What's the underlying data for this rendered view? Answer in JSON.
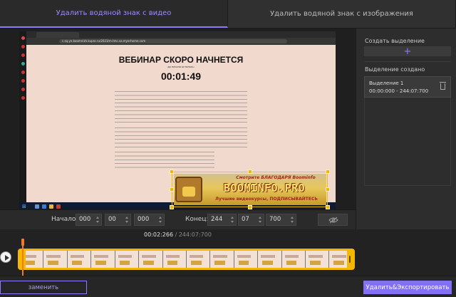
{
  "tabs": [
    {
      "label": "Удалить водяной знак с видео",
      "active": true
    },
    {
      "label": "Удалить водяной знак с изображения",
      "active": false
    }
  ],
  "accent_color": "#8b7cff",
  "selection_color": "#f5b800",
  "video": {
    "address": "c.sq.ye.baomnizh.kupro.ru/2023/m.tmc.sa.myerhome.com",
    "page_title": "ВЕБИНАР СКОРО НАЧНЕТСЯ",
    "page_subtitle": "до начала осталось:",
    "page_timer": "00:01:49",
    "watermark": {
      "top": "Смотрите БЛАГОДАРЯ Boominfo",
      "main": "BOOMINFO.PRO",
      "bottom": "Лучшие видеокурсы, ПОДПИСЫВАЙТЕСЬ"
    }
  },
  "time_bar": {
    "start_label": "Начало:",
    "start": [
      "000",
      "00",
      "000"
    ],
    "end_label": "Конец:",
    "end": [
      "244",
      "07",
      "700"
    ],
    "hide_icon": "eye-off-icon"
  },
  "timeline": {
    "current": "00:02:266",
    "separator": " / ",
    "total": "244:07:700",
    "play_icon": "play-icon"
  },
  "panel": {
    "create_label": "Создать выделение",
    "add_icon": "plus-icon",
    "created_label": "Выделение создано",
    "selection": {
      "name": "Выделение 1",
      "range": "00:00:000 - 244:07:700",
      "delete_icon": "trash-icon"
    }
  },
  "bottom": {
    "replace_label": "заменить",
    "export_label": "Удалить&Экспортировать"
  }
}
